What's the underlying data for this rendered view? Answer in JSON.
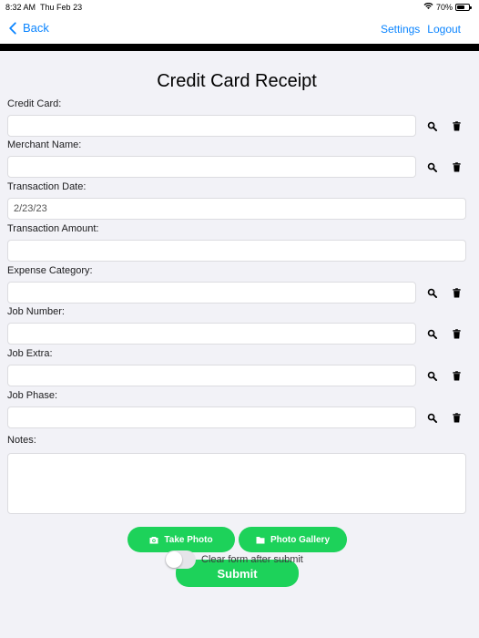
{
  "status_bar": {
    "time": "8:32 AM",
    "date": "Thu Feb 23",
    "battery_text": "70%",
    "battery_level": 0.7,
    "wifi_icon": "wifi-icon"
  },
  "nav": {
    "back_label": "Back",
    "settings_label": "Settings",
    "logout_label": "Logout"
  },
  "page": {
    "title": "Credit Card Receipt"
  },
  "form": {
    "credit_card": {
      "label": "Credit Card:",
      "value": ""
    },
    "merchant_name": {
      "label": "Merchant Name:",
      "value": ""
    },
    "transaction_date": {
      "label": "Transaction Date:",
      "value": "2/23/23"
    },
    "transaction_amount": {
      "label": "Transaction Amount:",
      "value": ""
    },
    "expense_category": {
      "label": "Expense Category:",
      "value": ""
    },
    "job_number": {
      "label": "Job Number:",
      "value": ""
    },
    "job_extra": {
      "label": "Job Extra:",
      "value": ""
    },
    "job_phase": {
      "label": "Job Phase:",
      "value": ""
    },
    "notes": {
      "label": "Notes:",
      "value": ""
    }
  },
  "buttons": {
    "take_photo": "Take Photo",
    "photo_gallery": "Photo Gallery",
    "submit": "Submit"
  },
  "toggle": {
    "label": "Clear form after submit",
    "on": false
  },
  "colors": {
    "accent": "#0a84ff",
    "green": "#1dd25a",
    "background": "#f2f2f7"
  }
}
